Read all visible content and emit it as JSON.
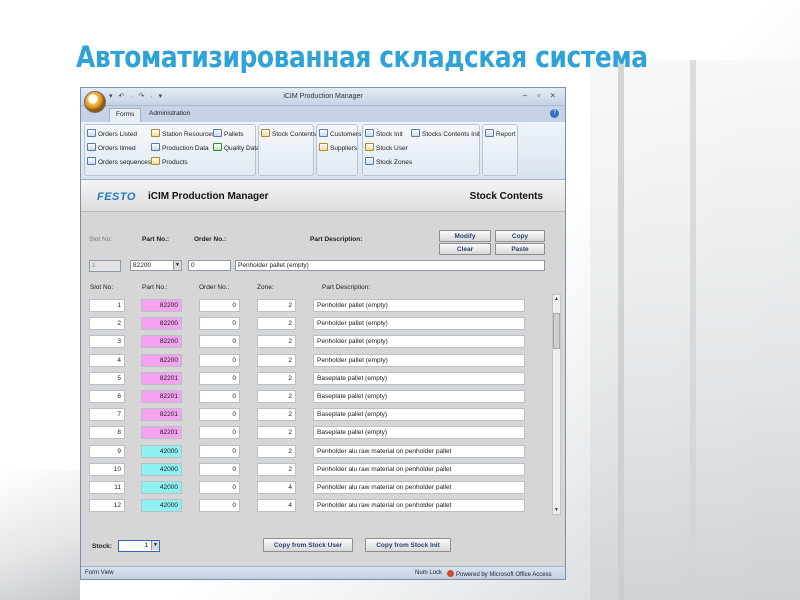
{
  "slide": {
    "title": "Автоматизированная складская система"
  },
  "window": {
    "title": "iCIM Production Manager",
    "qat": "▾ ↶ · ↷ · ▾",
    "controls": "– ▫ ×"
  },
  "tabs": [
    {
      "label": "Forms"
    },
    {
      "label": "Administration"
    }
  ],
  "ribbon": {
    "group1": [
      "Orders Listed",
      "Orders timed",
      "Orders sequences"
    ],
    "group2": [
      "Station Resources",
      "Production Data",
      "Products"
    ],
    "group3": [
      "Pallets",
      "Quality Data"
    ],
    "group4": [
      "Stock Contents"
    ],
    "group5": [
      "Customers",
      "Suppliers"
    ],
    "group6": [
      "Stock Init",
      "Stock User",
      "Stock Zones"
    ],
    "group7": [
      "Stocks Contents Init"
    ],
    "group8": [
      "Report"
    ]
  },
  "header": {
    "brand": "FESTO",
    "app_name": "iCIM Production Manager",
    "form_name": "Stock Contents"
  },
  "edit": {
    "slot_label": "Slot No:",
    "part_label": "Part No.:",
    "order_label": "Order No.:",
    "desc_label": "Part Description:",
    "slot_value": "1",
    "part_value": "82200",
    "order_value": "0",
    "desc_value": "Penholder pallet (empty)",
    "buttons": {
      "modify": "Modify",
      "clear": "Clear",
      "copy": "Copy",
      "paste": "Paste"
    }
  },
  "grid": {
    "headers": {
      "slot": "Slot No:",
      "part": "Part No.:",
      "order": "Order No.:",
      "zone": "Zone:",
      "desc": "Part Description:"
    },
    "colors": {
      "magenta": "#f5a3f0",
      "cyan": "#8ff0f0"
    },
    "rows": [
      {
        "slot": "1",
        "part": "82200",
        "order": "0",
        "zone": "2",
        "desc": "Penholder pallet (empty)",
        "color": "magenta"
      },
      {
        "slot": "2",
        "part": "82200",
        "order": "0",
        "zone": "2",
        "desc": "Penholder pallet (empty)",
        "color": "magenta"
      },
      {
        "slot": "3",
        "part": "82200",
        "order": "0",
        "zone": "2",
        "desc": "Penholder pallet (empty)",
        "color": "magenta"
      },
      {
        "slot": "4",
        "part": "82200",
        "order": "0",
        "zone": "2",
        "desc": "Penholder pallet (empty)",
        "color": "magenta"
      },
      {
        "slot": "5",
        "part": "82201",
        "order": "0",
        "zone": "2",
        "desc": "Baseplate pallet (empty)",
        "color": "magenta"
      },
      {
        "slot": "6",
        "part": "82201",
        "order": "0",
        "zone": "2",
        "desc": "Baseplate pallet (empty)",
        "color": "magenta"
      },
      {
        "slot": "7",
        "part": "82201",
        "order": "0",
        "zone": "2",
        "desc": "Baseplate pallet (empty)",
        "color": "magenta"
      },
      {
        "slot": "8",
        "part": "82201",
        "order": "0",
        "zone": "2",
        "desc": "Baseplate pallet (empty)",
        "color": "magenta"
      },
      {
        "slot": "9",
        "part": "42000",
        "order": "0",
        "zone": "2",
        "desc": "Penholder alu raw material on penholder pallet",
        "color": "cyan"
      },
      {
        "slot": "10",
        "part": "42000",
        "order": "0",
        "zone": "2",
        "desc": "Penholder alu raw material on penholder pallet",
        "color": "cyan"
      },
      {
        "slot": "11",
        "part": "42000",
        "order": "0",
        "zone": "4",
        "desc": "Penholder alu raw material on penholder pallet",
        "color": "cyan"
      },
      {
        "slot": "12",
        "part": "42000",
        "order": "0",
        "zone": "4",
        "desc": "Penholder alu raw material on penholder pallet",
        "color": "cyan"
      }
    ]
  },
  "footer": {
    "stock_label": "Stock:",
    "stock_value": "1",
    "copy_user": "Copy from Stock User",
    "copy_init": "Copy from Stock Init"
  },
  "status": {
    "left": "Form View",
    "num_lock": "Num Lock",
    "powered": "Powered by Microsoft Office Access"
  }
}
